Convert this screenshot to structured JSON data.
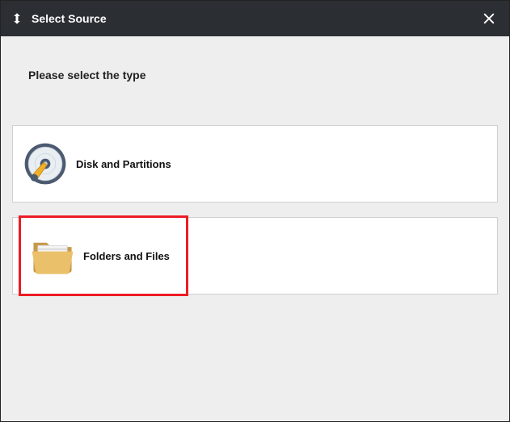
{
  "titlebar": {
    "title": "Select Source"
  },
  "prompt": "Please select the type",
  "options": [
    {
      "label": "Disk and Partitions",
      "icon": "disk-icon",
      "highlighted": false
    },
    {
      "label": "Folders and Files",
      "icon": "folder-icon",
      "highlighted": true
    }
  ]
}
